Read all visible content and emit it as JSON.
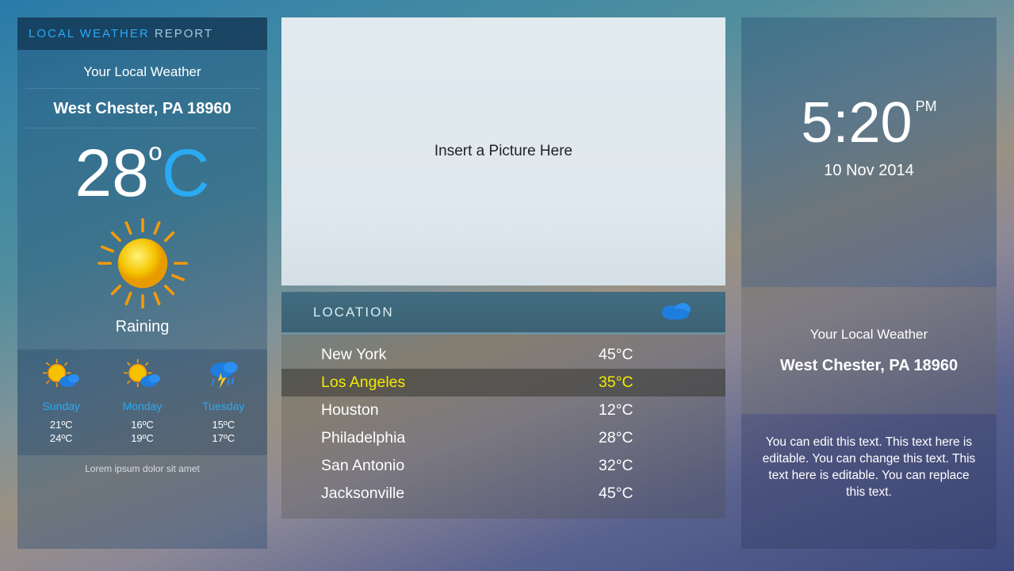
{
  "left": {
    "header_prefix": "LOCAL WEATHER",
    "header_suffix": " REPORT",
    "subtitle": "Your Local Weather",
    "location": "West Chester, PA 18960",
    "temp_value": "28",
    "temp_degree": "º",
    "temp_unit": "C",
    "condition": "Raining",
    "forecast": [
      {
        "day": "Sunday",
        "lo": "21ºC",
        "hi": "24ºC",
        "icon": "sun-cloud"
      },
      {
        "day": "Monday",
        "lo": "16ºC",
        "hi": "19ºC",
        "icon": "sun-cloud"
      },
      {
        "day": "Tuesday",
        "lo": "15ºC",
        "hi": "17ºC",
        "icon": "storm"
      }
    ],
    "footnote": "Lorem ipsum dolor sit amet"
  },
  "center": {
    "picture_placeholder": "Insert a Picture Here",
    "location_header": "LOCATION",
    "locations": [
      {
        "name": "New York",
        "temp": "45°C",
        "selected": false
      },
      {
        "name": "Los  Angeles",
        "temp": "35°C",
        "selected": true
      },
      {
        "name": "Houston",
        "temp": "12°C",
        "selected": false
      },
      {
        "name": "Philadelphia",
        "temp": "28°C",
        "selected": false
      },
      {
        "name": "San Antonio",
        "temp": "32°C",
        "selected": false
      },
      {
        "name": "Jacksonville",
        "temp": "45°C",
        "selected": false
      }
    ]
  },
  "right": {
    "time": "5:20",
    "ampm": "PM",
    "date": "10 Nov 2014",
    "subtitle": "Your Local Weather",
    "location": "West Chester, PA 18960",
    "blurb": "You can edit this text. This text here is editable. You can change this text. This text here is editable. You can replace this text."
  }
}
